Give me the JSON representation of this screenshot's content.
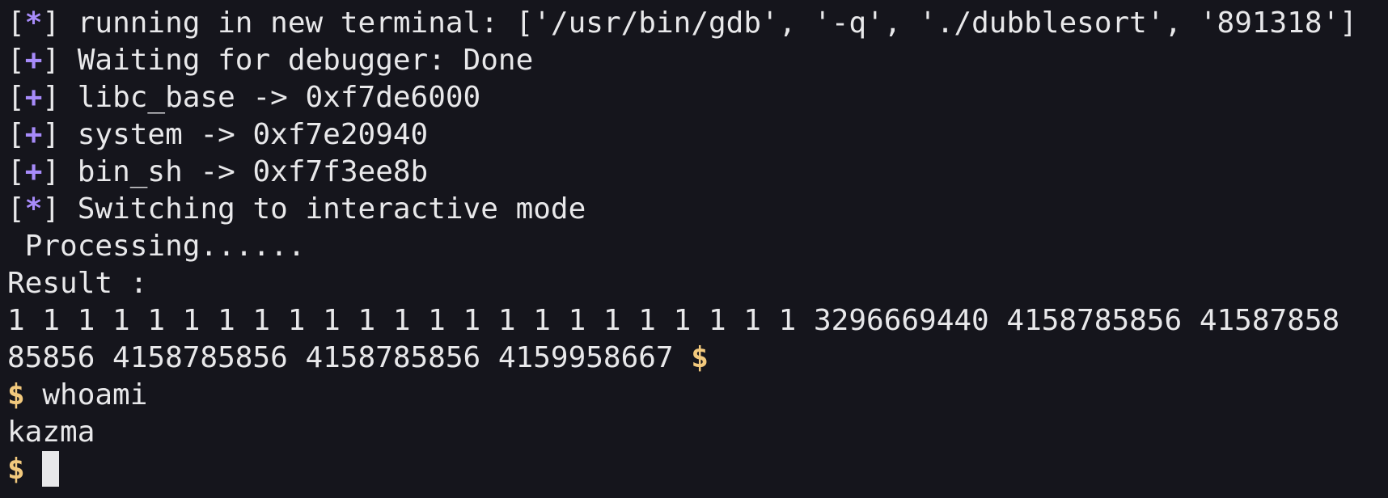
{
  "terminal": {
    "lines": [
      {
        "kind": "status",
        "bracket_left": "[",
        "symbol": "*",
        "bracket_right": "]",
        "text": " running in new terminal: ['/usr/bin/gdb', '-q', './dubblesort', '891318']"
      },
      {
        "kind": "status",
        "bracket_left": "[",
        "symbol": "+",
        "bracket_right": "]",
        "text": " Waiting for debugger: Done"
      },
      {
        "kind": "status",
        "bracket_left": "[",
        "symbol": "+",
        "bracket_right": "]",
        "text": " libc_base -> 0xf7de6000"
      },
      {
        "kind": "status",
        "bracket_left": "[",
        "symbol": "+",
        "bracket_right": "]",
        "text": " system -> 0xf7e20940"
      },
      {
        "kind": "status",
        "bracket_left": "[",
        "symbol": "+",
        "bracket_right": "]",
        "text": " bin_sh -> 0xf7f3ee8b"
      },
      {
        "kind": "status",
        "bracket_left": "[",
        "symbol": "*",
        "bracket_right": "]",
        "text": " Switching to interactive mode"
      },
      {
        "kind": "output",
        "text": " Processing......"
      },
      {
        "kind": "output",
        "text": "Result :"
      },
      {
        "kind": "output",
        "text": "1 1 1 1 1 1 1 1 1 1 1 1 1 1 1 1 1 1 1 1 1 1 1 3296669440 4158785856 41587858"
      },
      {
        "kind": "output_prompt",
        "text": "85856 4158785856 4158785856 4159958667 ",
        "prompt": "$"
      },
      {
        "kind": "command",
        "prompt": "$",
        "text": " whoami"
      },
      {
        "kind": "output",
        "text": "kazma"
      },
      {
        "kind": "cursor_line",
        "prompt": "$",
        "text": " "
      }
    ]
  },
  "colors": {
    "background": "#15151c",
    "foreground": "#e8e8ea",
    "status_symbol": "#a78bfa",
    "prompt": "#f2c97d"
  }
}
